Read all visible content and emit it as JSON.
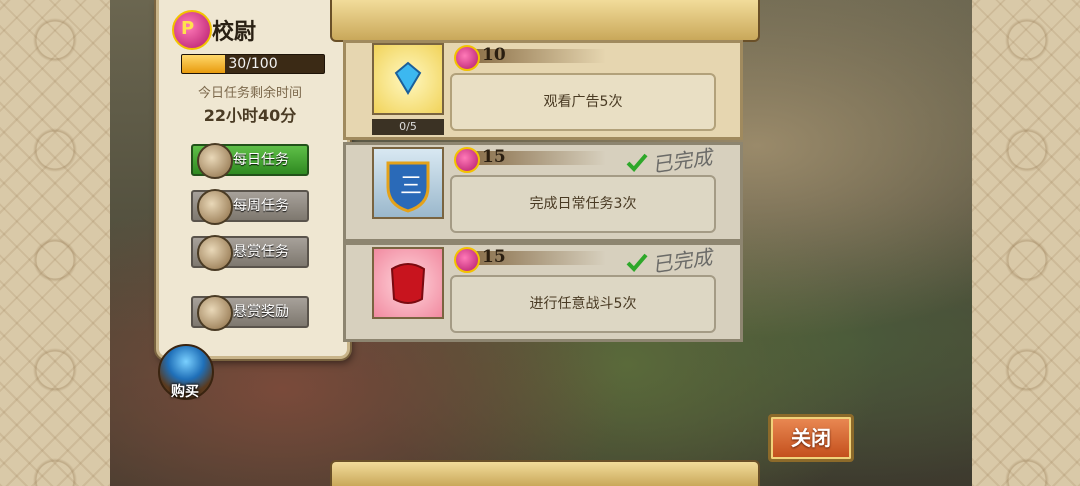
{
  "rank": {
    "title": "校尉"
  },
  "progress": {
    "text": "30/100",
    "fraction": 0.3
  },
  "remaining": {
    "label": "今日任务剩余时间",
    "time": "22小时40分"
  },
  "tabs": [
    {
      "label": "每日任务",
      "active": true,
      "icon": "daily-task-icon"
    },
    {
      "label": "每周任务",
      "active": false,
      "icon": "weekly-task-icon"
    },
    {
      "label": "悬赏任务",
      "active": false,
      "icon": "bounty-task-icon"
    },
    {
      "label": "悬赏奖励",
      "active": false,
      "icon": "bounty-reward-icon"
    }
  ],
  "buy": {
    "label": "购买"
  },
  "tasks": [
    {
      "reward": "10",
      "description": "观看广告5次",
      "count": "0/5",
      "done": false,
      "icon": "diamond-icon"
    },
    {
      "reward": "15",
      "description": "完成日常任务3次",
      "done": true,
      "status": "已完成",
      "icon": "badge-shield-icon"
    },
    {
      "reward": "15",
      "description": "进行任意战斗5次",
      "done": true,
      "status": "已完成",
      "icon": "red-flag-icon"
    }
  ],
  "close": {
    "label": "关闭"
  }
}
